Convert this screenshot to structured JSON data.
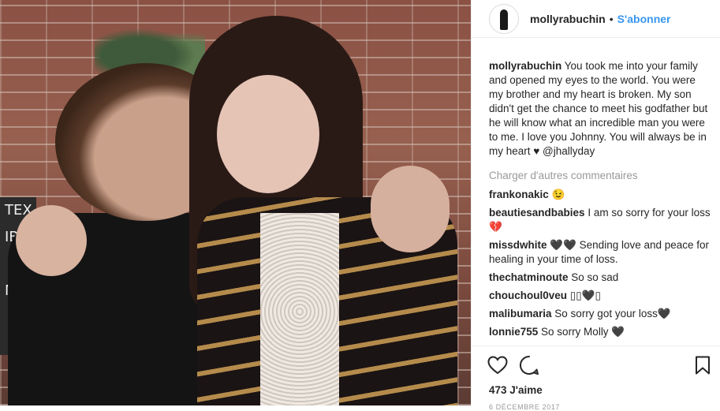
{
  "header": {
    "username": "mollyrabuchin",
    "separator": "•",
    "follow_label": "S'abonner"
  },
  "photo": {
    "sign_text": "TEX\nIBO\n\nMO"
  },
  "caption": {
    "username": "mollyrabuchin",
    "text": "You took me into your family and opened my eyes to the world. You were my brother and my heart is broken. My son didn't get the chance to meet his godfather but he will know what an incredible man you were to me. I love you Johnny. You will always be in my heart ♥ @jhallyday"
  },
  "load_more_label": "Charger d'autres commentaires",
  "comments": [
    {
      "user": "frankonakic",
      "text": "😉"
    },
    {
      "user": "beautiesandbabies",
      "text": "I am so sorry for your loss 💔"
    },
    {
      "user": "missdwhite",
      "text": "🖤🖤 Sending love and peace for healing in your time of loss."
    },
    {
      "user": "thechatminoute",
      "text": "So so sad"
    },
    {
      "user": "chouchoul0veu",
      "text": "▯▯🖤▯"
    },
    {
      "user": "malibumaria",
      "text": "So sorry got your loss🖤"
    },
    {
      "user": "lonnie755",
      "text": "So sorry Molly 🖤"
    }
  ],
  "actions": {
    "like_icon": "heart-icon",
    "comment_icon": "comment-icon",
    "save_icon": "bookmark-icon"
  },
  "likes_label": "473 J'aime",
  "date_label": "6 DÉCEMBRE 2017"
}
